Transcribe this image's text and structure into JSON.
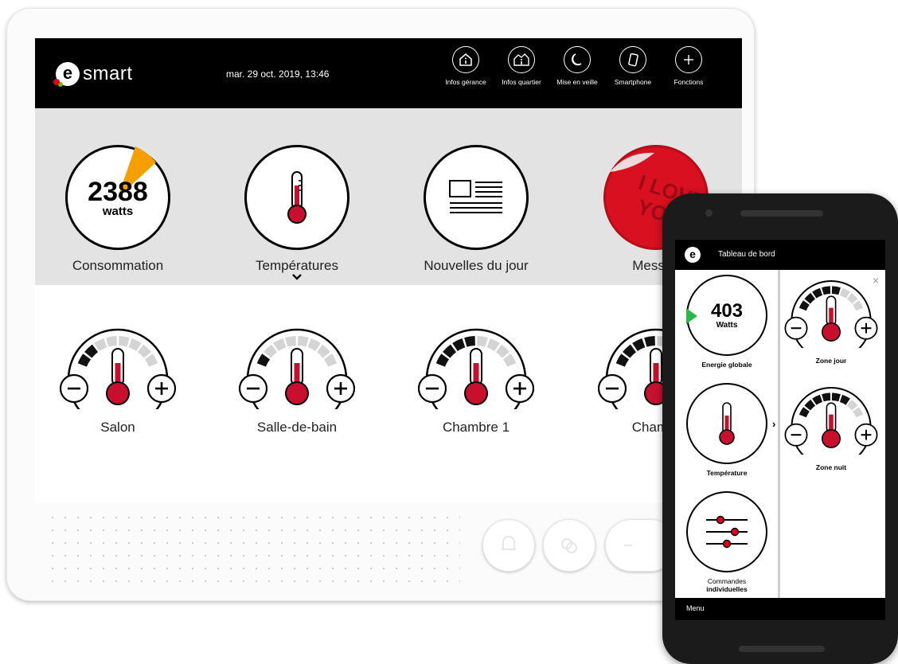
{
  "tablet": {
    "brand": "smart",
    "brand_letter": "e",
    "datetime": "mar. 29 oct. 2019, 13:46",
    "toolbar": [
      {
        "label": "Infos gérance",
        "icon": "house-info-icon"
      },
      {
        "label": "Infos quartier",
        "icon": "neighborhood-info-icon"
      },
      {
        "label": "Mise en veille",
        "icon": "moon-icon"
      },
      {
        "label": "Smartphone",
        "icon": "smartphone-icon"
      },
      {
        "label": "Fonctions",
        "icon": "plus-icon"
      }
    ],
    "tiles": {
      "consumption": {
        "value": "2388",
        "unit": "watts",
        "label": "Consommation"
      },
      "temperatures": {
        "label": "Températures"
      },
      "news": {
        "label": "Nouvelles du jour"
      },
      "messages": {
        "label": "Messag",
        "sticker": "I LOVE YOU"
      }
    },
    "zones": [
      {
        "label": "Salon",
        "level": 0.3
      },
      {
        "label": "Salle-de-bain",
        "level": 0.15
      },
      {
        "label": "Chambre 1",
        "level": 0.45
      },
      {
        "label": "Chambr",
        "level": 0.45
      }
    ]
  },
  "phone": {
    "brand_letter": "e",
    "title": "Tableau de bord",
    "energy": {
      "value": "403",
      "unit": "Watts",
      "label": "Energie globale"
    },
    "temperature": {
      "label": "Température"
    },
    "controls": {
      "label_line1": "Commandes",
      "label_line2": "individuelles"
    },
    "zones": [
      {
        "label": "Zone jour",
        "level": 0.6
      },
      {
        "label": "Zone nuit",
        "level": 0.75
      }
    ],
    "close": "×",
    "chevron": "›",
    "menu": "Menu"
  },
  "colors": {
    "accent_red": "#e2001a",
    "accent_orange": "#f5a000",
    "accent_green": "#2bb84a",
    "thermo_red": "#c8102e"
  }
}
